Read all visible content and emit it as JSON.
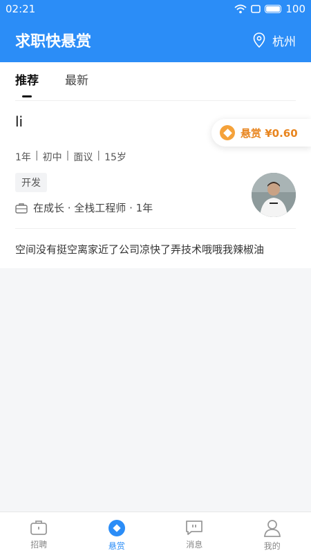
{
  "status_bar": {
    "time": "02:21",
    "battery": "100"
  },
  "header": {
    "title": "求职快悬赏",
    "city": "杭州"
  },
  "tabs": [
    {
      "label": "推荐",
      "active": true
    },
    {
      "label": "最新",
      "active": false
    }
  ],
  "job": {
    "title": "li",
    "bounty": "悬赏 ¥0.60",
    "meta": [
      "1年",
      "初中",
      "面议",
      "15岁"
    ],
    "meta_separator": "|",
    "tag": "开发",
    "work": "在成长 · 全栈工程师 · 1年",
    "description": "空间没有挺空离家近了公司凉快了弄技术哦哦我辣椒油"
  },
  "nav": [
    {
      "label": "招聘",
      "icon": "briefcase-icon"
    },
    {
      "label": "悬赏",
      "icon": "bounty-icon",
      "active": true
    },
    {
      "label": "消息",
      "icon": "message-icon"
    },
    {
      "label": "我的",
      "icon": "profile-icon"
    }
  ],
  "colors": {
    "primary": "#2b8df7",
    "bounty": "#e8851f"
  }
}
